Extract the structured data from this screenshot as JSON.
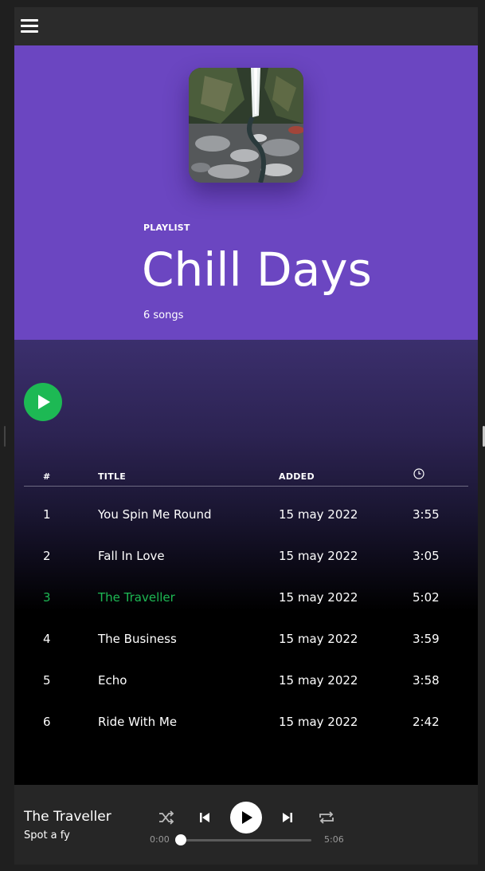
{
  "header": {
    "menu_icon": "hamburger-menu-icon"
  },
  "playlist": {
    "type_label": "PLAYLIST",
    "title": "Chill Days",
    "song_count": "6 songs",
    "accent_color": "#6b46c1"
  },
  "table": {
    "headers": {
      "number": "#",
      "title": "TITLE",
      "added": "ADDED",
      "duration_icon": "clock-icon"
    },
    "rows": [
      {
        "number": "1",
        "title": "You Spin Me Round",
        "added": "15 may 2022",
        "duration": "3:55"
      },
      {
        "number": "2",
        "title": "Fall In Love",
        "added": "15 may 2022",
        "duration": "3:05"
      },
      {
        "number": "3",
        "title": "The Traveller",
        "added": "15 may 2022",
        "duration": "5:02"
      },
      {
        "number": "4",
        "title": "The Business",
        "added": "15 may 2022",
        "duration": "3:59"
      },
      {
        "number": "5",
        "title": "Echo",
        "added": "15 may 2022",
        "duration": "3:58"
      },
      {
        "number": "6",
        "title": "Ride With Me",
        "added": "15 may 2022",
        "duration": "2:42"
      }
    ],
    "active_index": 2,
    "active_color": "#1db954"
  },
  "player": {
    "track_title": "The Traveller",
    "artist": "Spot a fy",
    "current_time": "0:00",
    "total_time": "5:06",
    "progress": 0,
    "icons": [
      "shuffle-icon",
      "previous-icon",
      "play-icon",
      "next-icon",
      "repeat-icon"
    ]
  }
}
